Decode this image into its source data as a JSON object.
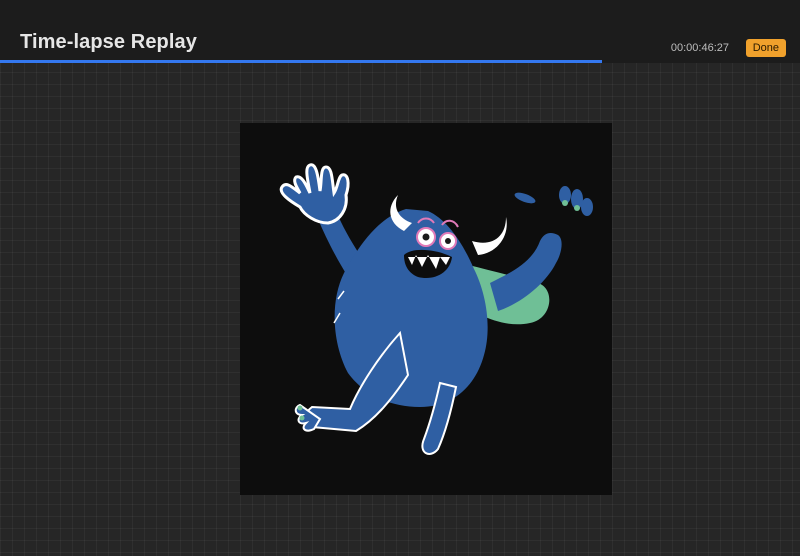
{
  "header": {
    "title": "Time-lapse Replay",
    "timecode": "00:00:46:27",
    "done_label": "Done"
  },
  "playback": {
    "progress": 0.753
  },
  "artwork": {
    "subject": "blue monster illustration",
    "background_color": "#0d0d0d",
    "body_color": "#2f5fa3",
    "tongue_color": "#6fbf96",
    "outline_color": "#ffffff"
  },
  "colors": {
    "accent": "#3478f0",
    "done_button": "#f0a12c",
    "header_bg": "#1c1c1c",
    "workspace_bg": "#262626"
  }
}
